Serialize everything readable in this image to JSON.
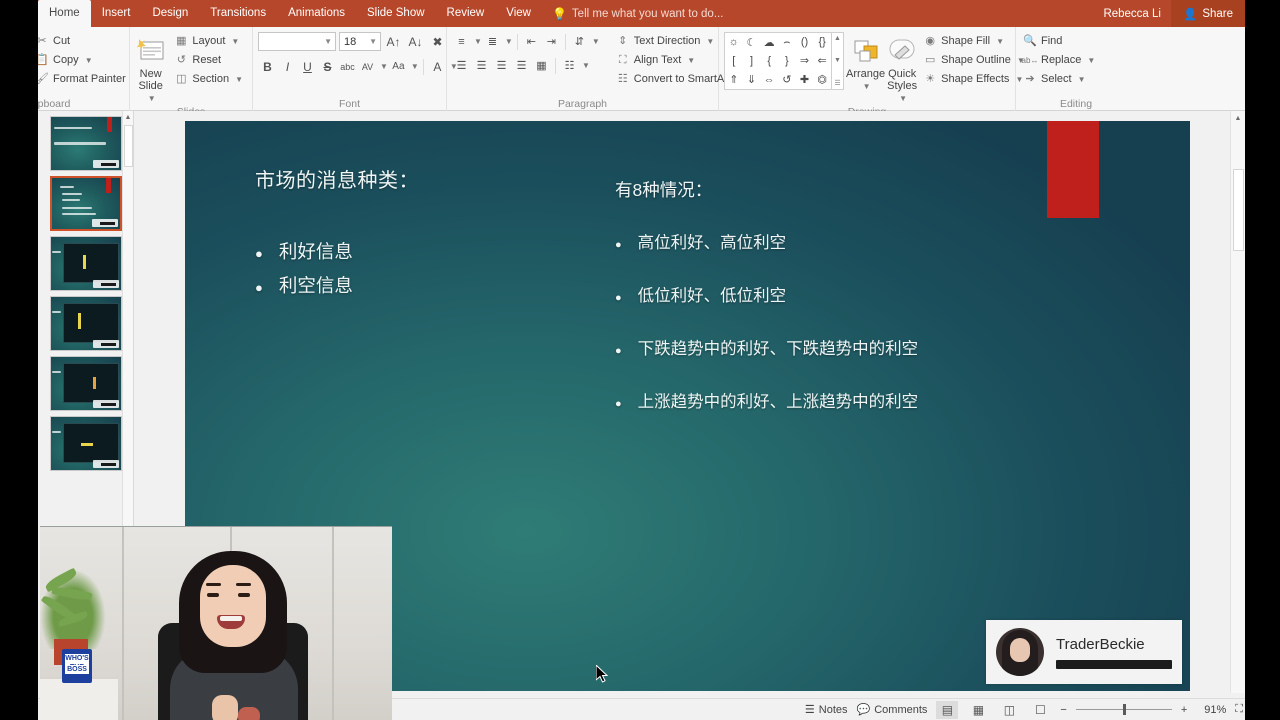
{
  "app": {
    "user": "Rebecca Li",
    "share_label": "Share",
    "tell_me_placeholder": "Tell me what you want to do..."
  },
  "ribbon": {
    "tabs": [
      {
        "label": "Home",
        "active": true
      },
      {
        "label": "Insert",
        "active": false
      },
      {
        "label": "Design",
        "active": false
      },
      {
        "label": "Transitions",
        "active": false
      },
      {
        "label": "Animations",
        "active": false
      },
      {
        "label": "Slide Show",
        "active": false
      },
      {
        "label": "Review",
        "active": false
      },
      {
        "label": "View",
        "active": false
      }
    ],
    "groups": {
      "clipboard": {
        "label": "lipboard",
        "cut": "Cut",
        "copy": "Copy",
        "format_painter": "Format Painter"
      },
      "slides": {
        "label": "Slides",
        "new_slide": "New\nSlide",
        "new_slide_line1": "New",
        "new_slide_line2": "Slide",
        "layout": "Layout",
        "reset": "Reset",
        "section": "Section"
      },
      "font": {
        "label": "Font",
        "font_name": "",
        "font_name_placeholder": "",
        "font_size": "18",
        "bold": "B",
        "italic": "I",
        "underline": "U",
        "strikethrough": "S",
        "shadow": "abc",
        "char_spacing": "AV",
        "change_case": "Aa",
        "font_color": "A",
        "grow_font": "A",
        "shrink_font": "A",
        "clear_formatting": "clear-formatting"
      },
      "paragraph": {
        "label": "Paragraph",
        "text_direction": "Text Direction",
        "align_text": "Align Text",
        "convert_smartart": "Convert to SmartArt"
      },
      "drawing": {
        "label": "Drawing",
        "arrange": "Arrange",
        "quick_styles_line1": "Quick",
        "quick_styles_line2": "Styles",
        "shape_fill": "Shape Fill",
        "shape_outline": "Shape Outline",
        "shape_effects": "Shape Effects",
        "shapes": [
          "☀",
          "☽",
          "☁",
          "⌒",
          "()",
          "{}",
          "[",
          "]",
          "{",
          "}",
          "⇨",
          "⇦",
          "⇧",
          "⇩",
          "⇔",
          "↻",
          "✥",
          "❈"
        ]
      },
      "editing": {
        "label": "Editing",
        "find": "Find",
        "replace": "Replace",
        "select": "Select"
      }
    }
  },
  "slide": {
    "left_column": {
      "heading": "市场的消息种类：",
      "bullets": [
        "利好信息",
        "利空信息"
      ]
    },
    "right_column": {
      "heading": "有8种情况：",
      "bullets": [
        "高位利好、高位利空",
        "低位利好、低位利空",
        "下跌趋势中的利好、下跌趋势中的利空",
        "上涨趋势中的利好、上涨趋势中的利空"
      ]
    },
    "accent_color": "#c0201c",
    "background_colors": [
      "#2f7c76",
      "#1b4f5c",
      "#163f50"
    ]
  },
  "watermark": {
    "name": "TraderBeckie"
  },
  "thumbnails": {
    "selected_index": 2,
    "slides": [
      {
        "index": "1"
      },
      {
        "index": "2"
      },
      {
        "index": "3"
      },
      {
        "index": "4"
      },
      {
        "index": "5"
      },
      {
        "index": "6"
      }
    ]
  },
  "status_bar": {
    "notes": "Notes",
    "comments": "Comments",
    "zoom_value": "91%",
    "views": [
      "normal-view",
      "slide-sorter-view",
      "reading-view",
      "slide-show-view"
    ]
  },
  "webcam": {
    "mug_line1": "WHO'S THE",
    "mug_line2": "BOSS"
  }
}
